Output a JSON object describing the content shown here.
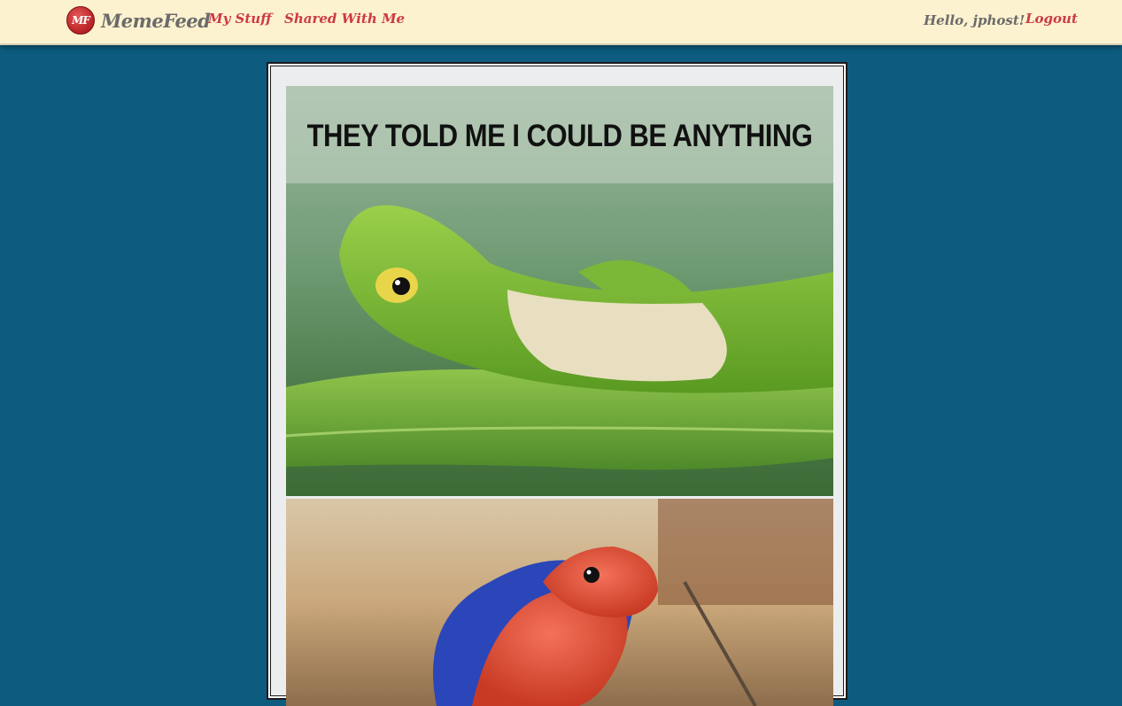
{
  "navbar": {
    "brand_logo_text": "MF",
    "brand_name": "MemeFeed",
    "links": [
      {
        "label": "My Stuff"
      },
      {
        "label": "Shared With Me"
      }
    ],
    "greeting": "Hello, jphost!",
    "logout_label": "Logout"
  },
  "meme": {
    "caption_top": "THEY TOLD ME I COULD BE ANYTHING"
  },
  "colors": {
    "page_background": "#0d5c80",
    "navbar_background": "#fdf2cf",
    "link_color": "#cc3a47",
    "brand_text": "#6b6b6b"
  }
}
